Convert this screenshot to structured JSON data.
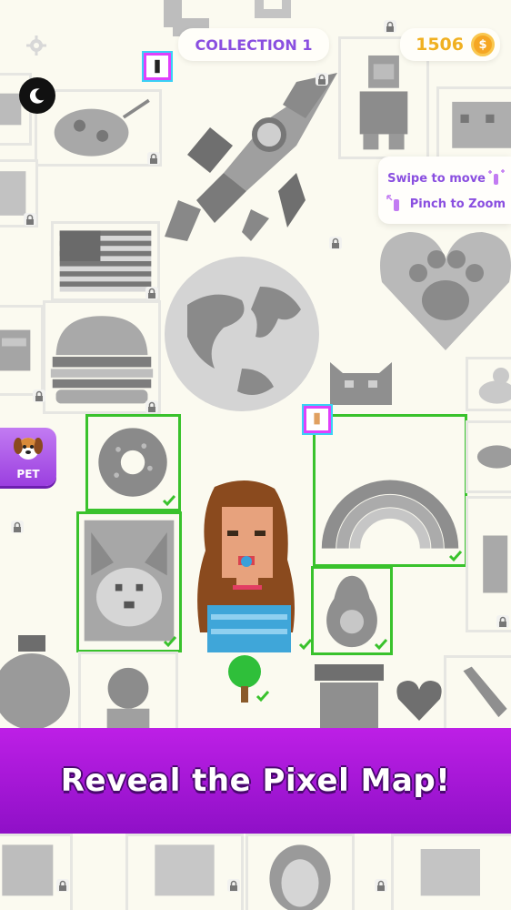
{
  "header": {
    "collection_label": "COLLECTION 1",
    "coin_count": "1506"
  },
  "hint": {
    "swipe_label": "Swipe to move",
    "pinch_label": "Pinch to Zoom"
  },
  "pet_button": {
    "label": "PET"
  },
  "banner": {
    "text": "Reveal the Pixel Map!"
  },
  "icons": [
    "gear-icon",
    "moon-icon",
    "coin-icon",
    "swipe-hand-icon",
    "pinch-hand-icon",
    "dog-icon",
    "lock-icon",
    "check-icon"
  ],
  "colors": {
    "accent_purple": "#8a4fe0",
    "banner_purple": "#a619d8",
    "completed_border": "#39c22c",
    "coin_gold": "#f5a623",
    "background": "#fbfaf0"
  }
}
